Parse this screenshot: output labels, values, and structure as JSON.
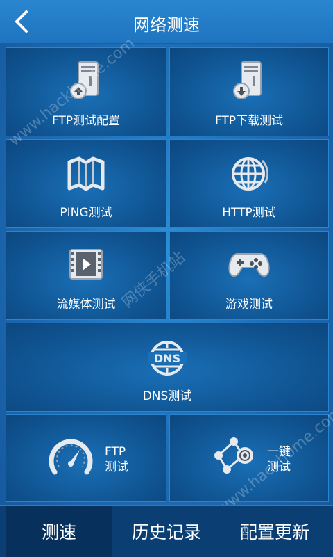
{
  "header": {
    "title": "网络测速"
  },
  "tiles": {
    "ftp_config": "FTP测试配置",
    "ftp_download": "FTP下载测试",
    "ping": "PING测试",
    "http": "HTTP测试",
    "streaming": "流媒体测试",
    "game": "游戏测试",
    "dns": "DNS测试",
    "ftp_test_line1": "FTP",
    "ftp_test_line2": "测试",
    "onekey_line1": "一键",
    "onekey_line2": "测试"
  },
  "tabs": [
    "测速",
    "历史记录",
    "配置更新"
  ],
  "watermarks": [
    "www.hackhome.com",
    "网侠手机站",
    "www.hackhome.com"
  ],
  "colors": {
    "accent": "#1f74bf",
    "tile": "#0f528f",
    "tabbar": "#0b3f74"
  },
  "icons": [
    "back-arrow-icon",
    "ftp-upload-server-icon",
    "ftp-download-server-icon",
    "map-icon",
    "globe-icon",
    "film-icon",
    "gamepad-icon",
    "dns-icon",
    "speedometer-icon",
    "share-nodes-icon"
  ]
}
